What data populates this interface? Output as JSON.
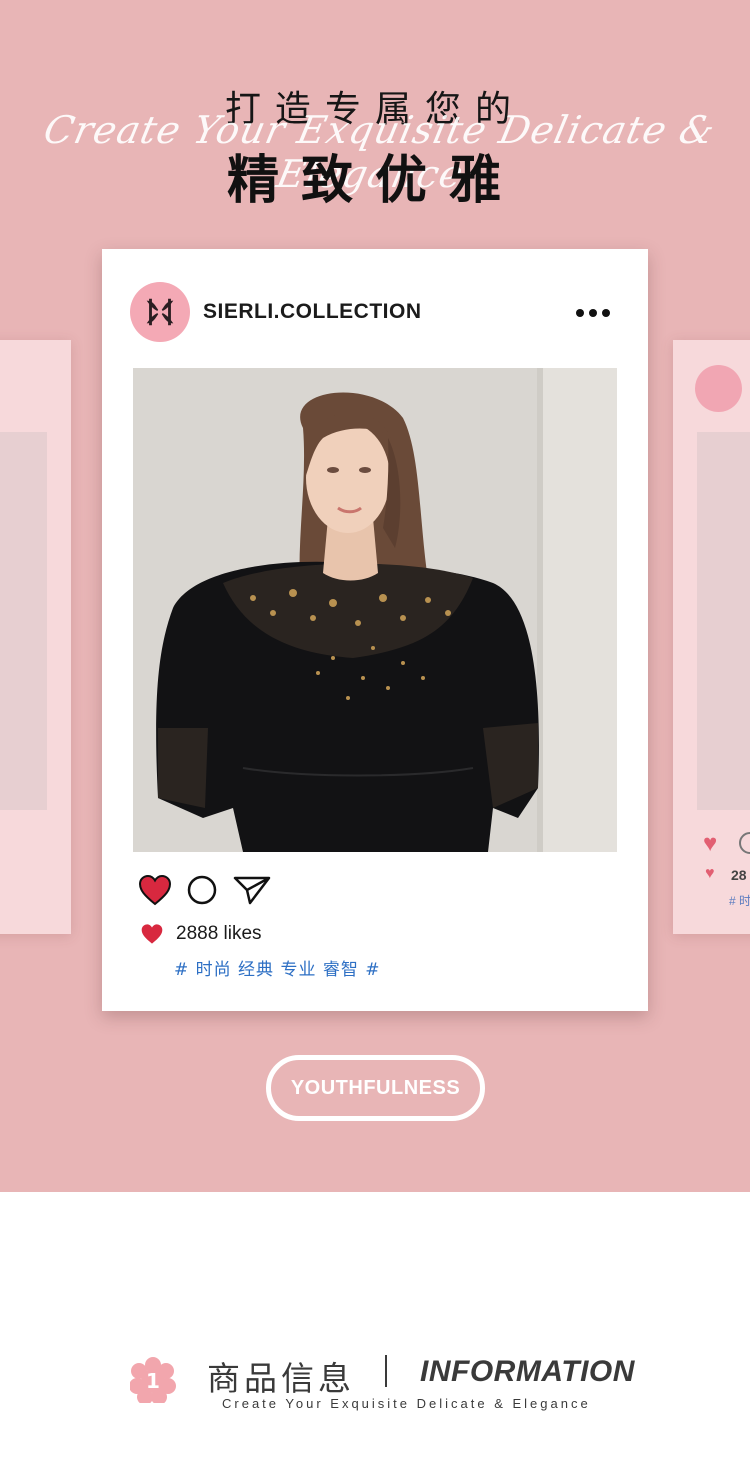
{
  "header": {
    "title_top": "打造专属您的",
    "script_line": "Create Your Exquisite Delicate & Elegance",
    "title_main": "精致优雅"
  },
  "post": {
    "username": "SIERLI.COLLECTION",
    "likes": "2888 likes",
    "tags": "# 时尚 经典 专业 睿智 #",
    "icons": [
      "heart-icon",
      "comment-icon",
      "send-icon",
      "more-icon"
    ]
  },
  "ghost_right": {
    "likes_partial": "28",
    "tag_partial": "# 时"
  },
  "badge_button": {
    "label": "YOUTHFULNESS"
  },
  "footer": {
    "badge_number": "1",
    "cn_title": "商品信息",
    "en_title": "INFORMATION",
    "subtitle": "Create Your Exquisite Delicate & Elegance"
  },
  "colors": {
    "hero_bg": "#e8b5b6",
    "card_pink": "#f7d9db",
    "avatar_pink": "#f4a9b5",
    "heart_red": "#d8283f",
    "tag_blue": "#2d6fc4",
    "text_dark": "#3a3a3a"
  }
}
